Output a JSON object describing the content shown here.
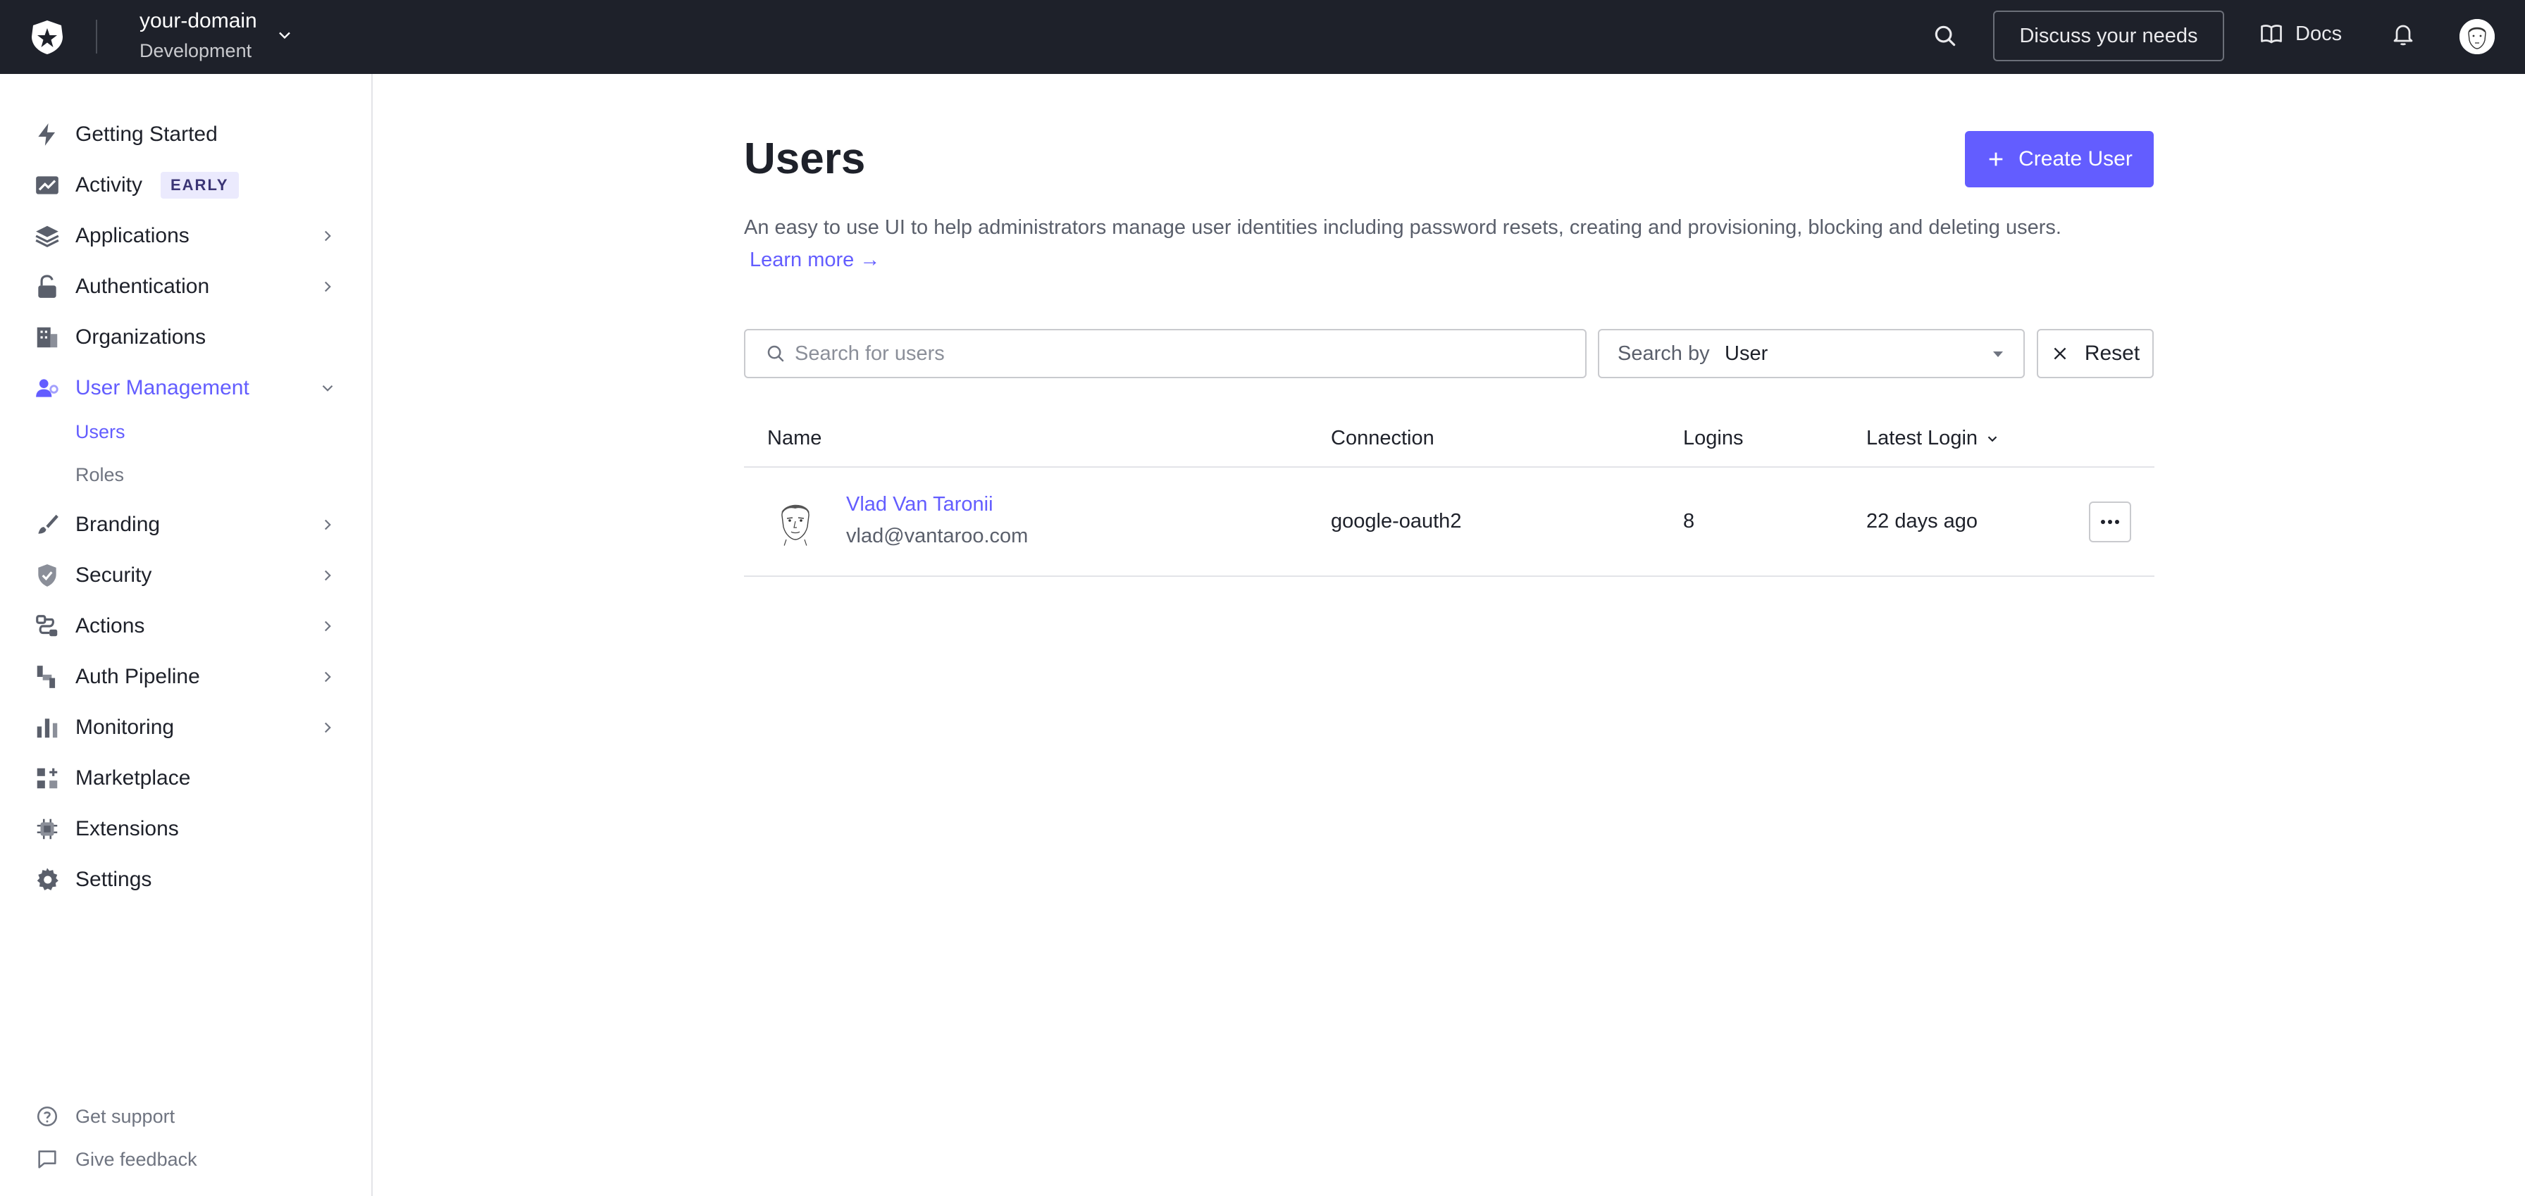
{
  "topbar": {
    "tenant_name": "your-domain",
    "tenant_env": "Development",
    "discuss_label": "Discuss your needs",
    "docs_label": "Docs"
  },
  "sidebar": {
    "items": [
      {
        "label": "Getting Started",
        "icon": "bolt-icon"
      },
      {
        "label": "Activity",
        "icon": "trend-icon",
        "badge": "EARLY"
      },
      {
        "label": "Applications",
        "icon": "layers-icon"
      },
      {
        "label": "Authentication",
        "icon": "lock-icon"
      },
      {
        "label": "Organizations",
        "icon": "building-icon"
      },
      {
        "label": "User Management",
        "icon": "users-icon"
      },
      {
        "label": "Branding",
        "icon": "brush-icon"
      },
      {
        "label": "Security",
        "icon": "shield-icon"
      },
      {
        "label": "Actions",
        "icon": "flow-icon"
      },
      {
        "label": "Auth Pipeline",
        "icon": "pipeline-icon"
      },
      {
        "label": "Monitoring",
        "icon": "bar-chart-icon"
      },
      {
        "label": "Marketplace",
        "icon": "grid-plus-icon"
      },
      {
        "label": "Extensions",
        "icon": "chip-icon"
      },
      {
        "label": "Settings",
        "icon": "gear-icon"
      }
    ],
    "sub_items": [
      "Users",
      "Roles"
    ],
    "footer": [
      {
        "label": "Get support",
        "icon": "help-icon"
      },
      {
        "label": "Give feedback",
        "icon": "chat-icon"
      }
    ]
  },
  "main": {
    "title": "Users",
    "create_label": "Create User",
    "description": "An easy to use UI to help administrators manage user identities including password resets, creating and provisioning, blocking and deleting users.",
    "learn_more": "Learn more →",
    "search_placeholder": "Search for users",
    "search_by_prefix": "Search by",
    "search_by_value": "User",
    "reset_label": "Reset",
    "table": {
      "headers": [
        "Name",
        "Connection",
        "Logins",
        "Latest Login"
      ],
      "rows": [
        {
          "name": "Vlad Van Taronii",
          "email": "vlad@vantaroo.com",
          "connection": "google-oauth2",
          "logins": "8",
          "latest": "22 days ago"
        }
      ]
    }
  },
  "colors": {
    "accent": "#635dff",
    "topbar": "#1e212a"
  }
}
